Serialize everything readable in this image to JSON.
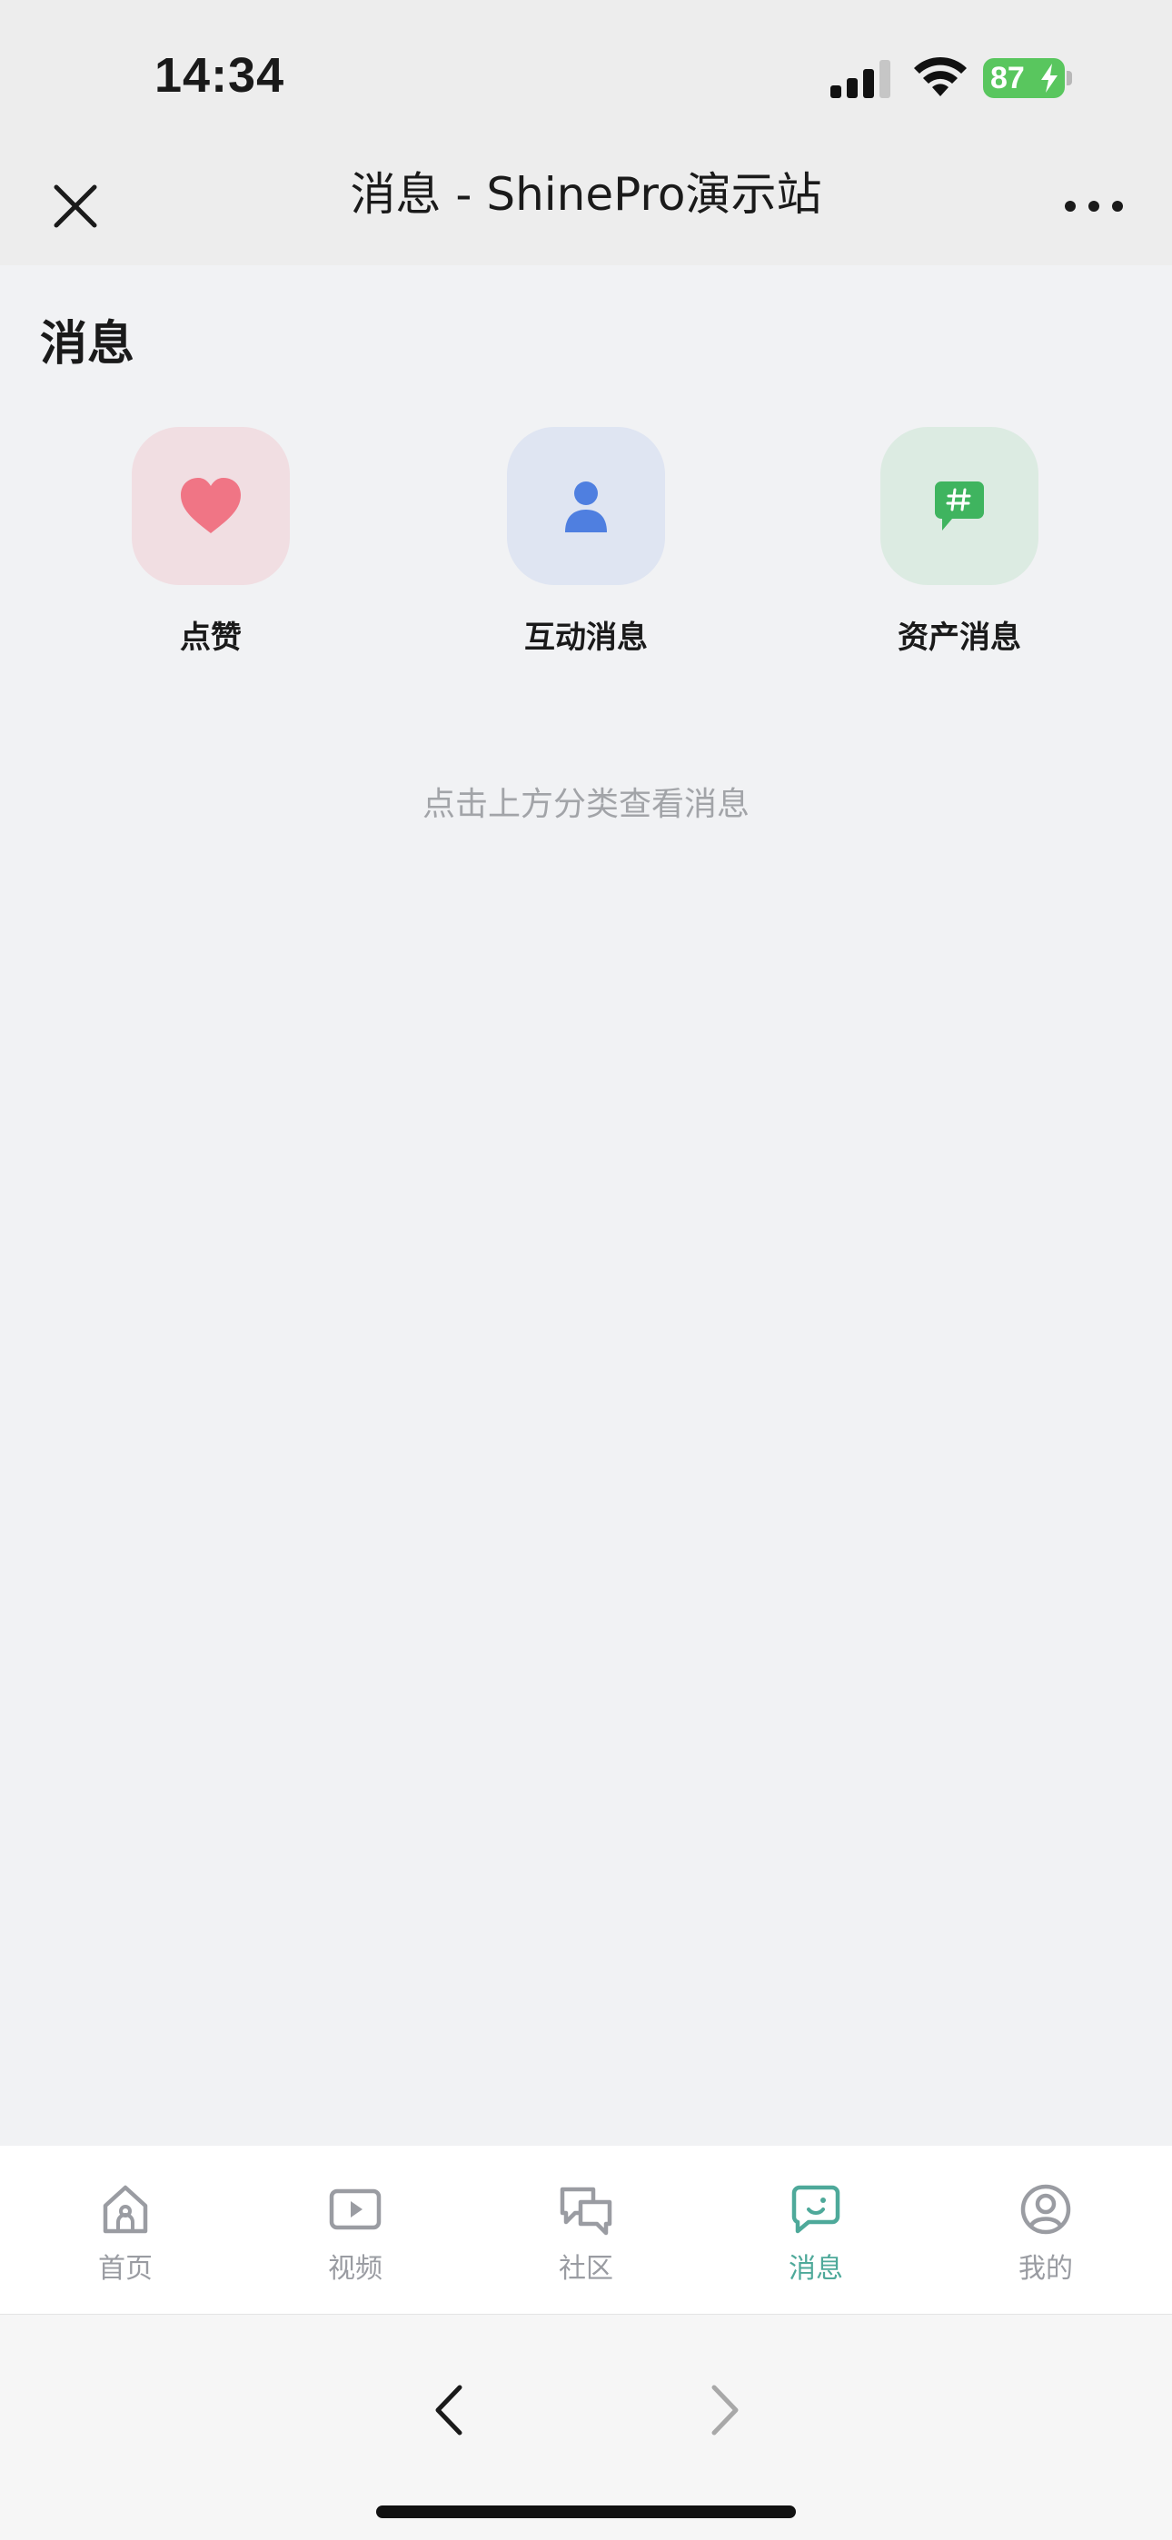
{
  "status_bar": {
    "time": "14:34",
    "battery_level": "87",
    "icons": [
      "signal-icon",
      "wifi-icon",
      "battery-charging-icon"
    ]
  },
  "nav_bar": {
    "title": "消息 - ShinePro演示站",
    "close_icon": "close-icon",
    "more_icon": "more-icon"
  },
  "page": {
    "heading": "消息",
    "categories": [
      {
        "label": "点赞",
        "icon": "heart-icon",
        "color": "#f07585",
        "bg": "#f1dee2"
      },
      {
        "label": "互动消息",
        "icon": "user-icon",
        "color": "#4f7fe0",
        "bg": "#dfe5f2"
      },
      {
        "label": "资产消息",
        "icon": "hashtag-chat-icon",
        "color": "#3fb45f",
        "bg": "#dcebe2"
      }
    ],
    "hint": "点击上方分类查看消息"
  },
  "tabbar": {
    "active_color": "#4ea99a",
    "inactive_color": "#9a9ca2",
    "items": [
      {
        "label": "首页",
        "icon": "home-icon",
        "active": false
      },
      {
        "label": "视频",
        "icon": "video-play-icon",
        "active": false
      },
      {
        "label": "社区",
        "icon": "community-chat-icon",
        "active": false
      },
      {
        "label": "消息",
        "icon": "message-icon",
        "active": true
      },
      {
        "label": "我的",
        "icon": "profile-icon",
        "active": false
      }
    ]
  },
  "browser_nav": {
    "back_icon": "chevron-left-icon",
    "forward_icon": "chevron-right-icon"
  }
}
